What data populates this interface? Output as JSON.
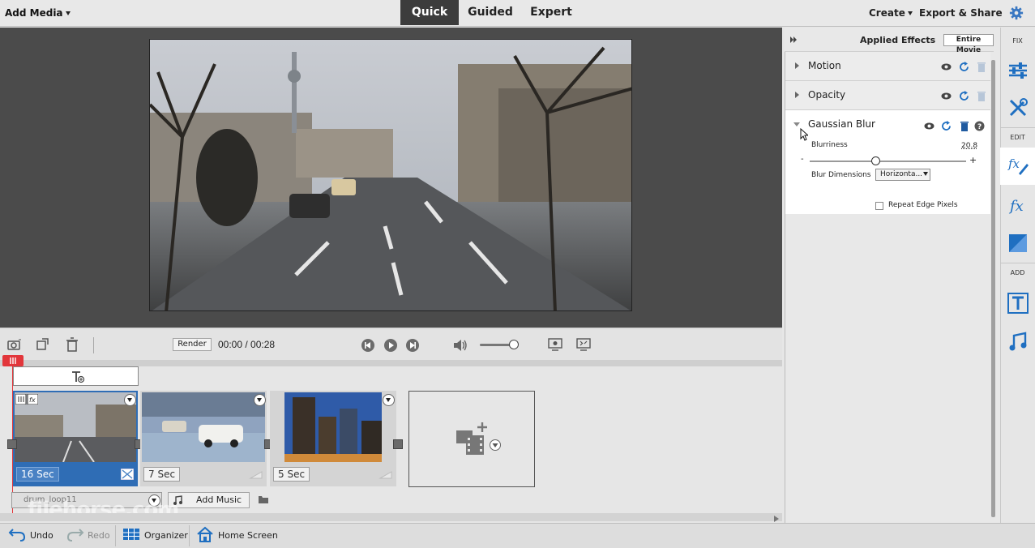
{
  "topbar": {
    "add_media": "Add Media",
    "modes": [
      "Quick",
      "Guided",
      "Expert"
    ],
    "active_mode": "Quick",
    "create": "Create",
    "export_share": "Export & Share"
  },
  "controls": {
    "render": "Render",
    "time_current": "00:00",
    "time_total": "00:28",
    "time_separator": " / "
  },
  "timeline": {
    "clips": [
      {
        "duration": "16 Sec",
        "selected": true
      },
      {
        "duration": "7 Sec",
        "selected": false
      },
      {
        "duration": "5 Sec",
        "selected": false
      }
    ],
    "music_track": "drum_loop11",
    "add_music": "Add Music"
  },
  "bottombar": {
    "undo": "Undo",
    "redo": "Redo",
    "organizer": "Organizer",
    "home_screen": "Home Screen"
  },
  "effects_panel": {
    "title": "Applied Effects",
    "scope_button": "Entire Movie",
    "effects": [
      {
        "name": "Motion",
        "expanded": false
      },
      {
        "name": "Opacity",
        "expanded": false
      },
      {
        "name": "Gaussian Blur",
        "expanded": true
      }
    ],
    "gaussian": {
      "blurriness_label": "Blurriness",
      "blurriness_value": "20.8",
      "slider_min_label": "-",
      "slider_max_label": "+",
      "slider_fraction": 0.42,
      "dimensions_label": "Blur Dimensions",
      "dimensions_value": "Horizonta...",
      "repeat_edge_label": "Repeat Edge Pixels",
      "repeat_edge_checked": false
    }
  },
  "right_toolbar": {
    "sections": [
      "FIX",
      "EDIT",
      "ADD"
    ],
    "icons": [
      "adjust-icon",
      "tools-icon",
      "fx-edit-icon",
      "fx-icon",
      "transition-icon",
      "title-icon",
      "music-icon"
    ]
  },
  "watermark": "filehorse.com",
  "colors": {
    "active_mode_bg": "#3c3c3c",
    "selected_clip": "#2f6db5",
    "playhead": "#e2363b",
    "accent_blue": "#1f6fc1"
  }
}
